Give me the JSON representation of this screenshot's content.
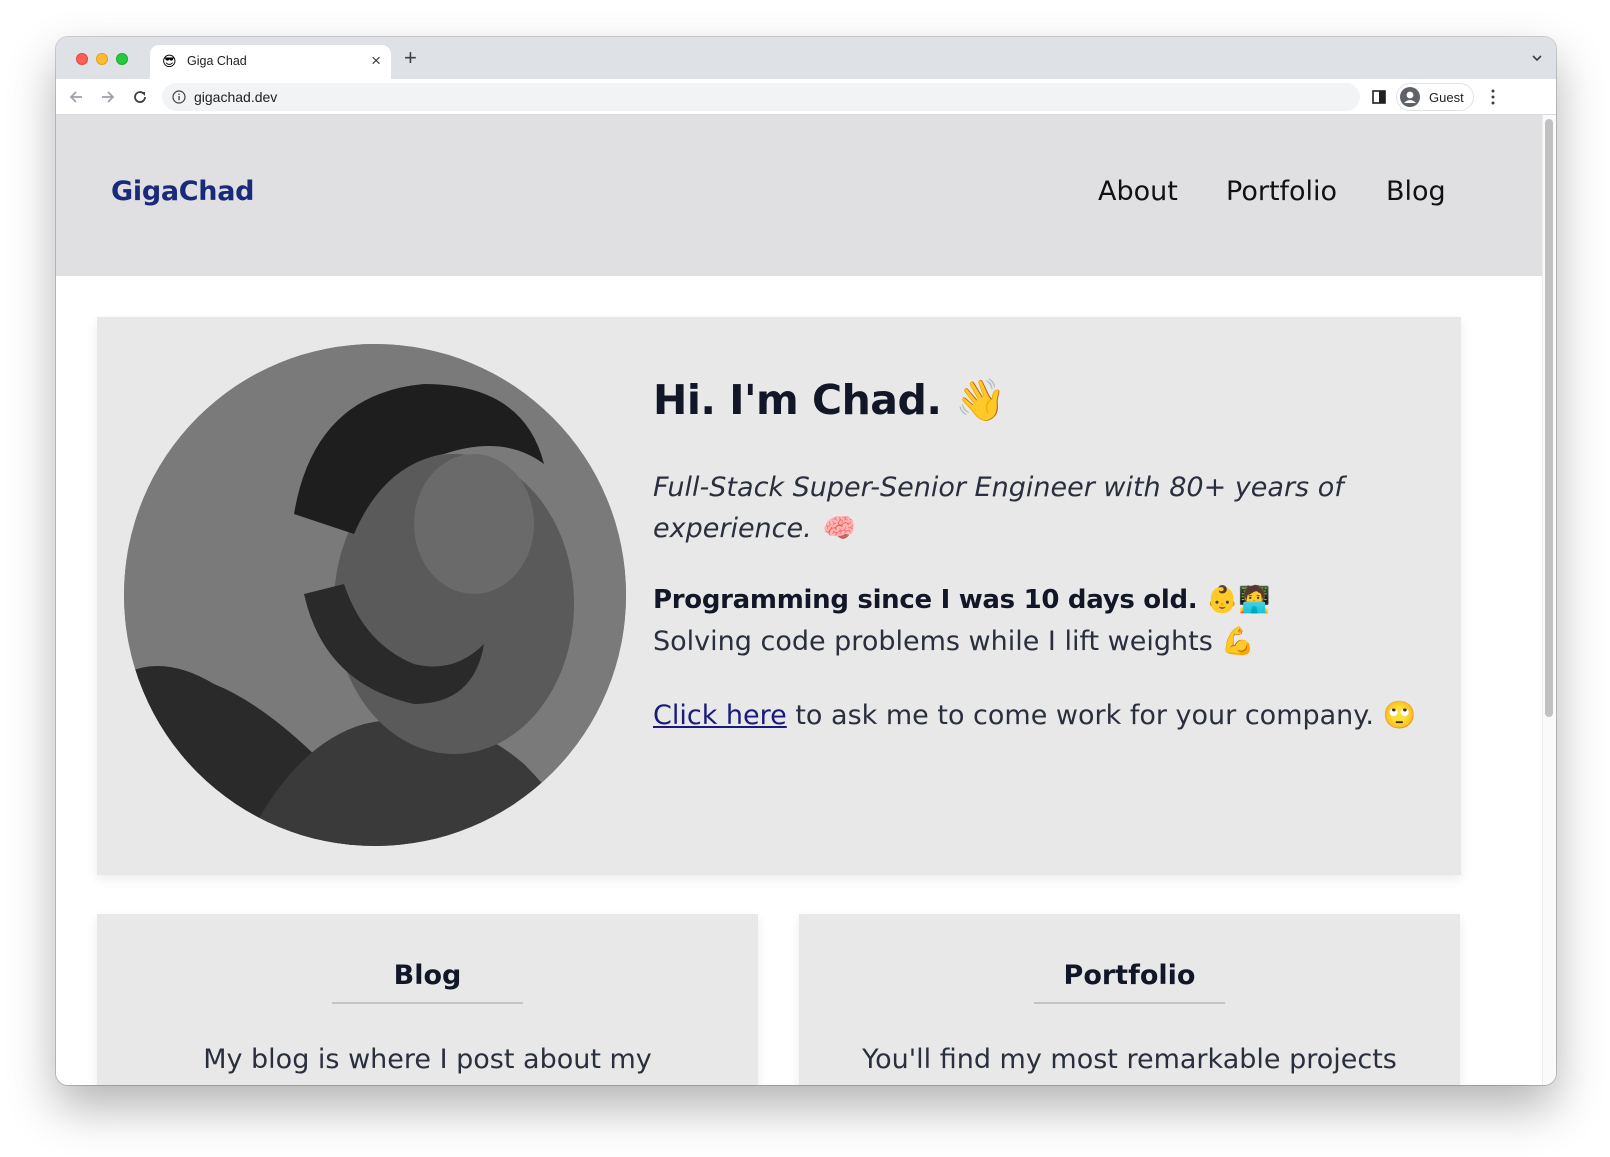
{
  "browser": {
    "tab": {
      "favicon": "😎",
      "title": "Giga Chad",
      "close": "×"
    },
    "new_tab": "+",
    "url": "gigachad.dev",
    "profile": "Guest"
  },
  "site": {
    "logo": "GigaChad",
    "nav": [
      {
        "label": "About"
      },
      {
        "label": "Portfolio"
      },
      {
        "label": "Blog"
      }
    ]
  },
  "hero": {
    "title": "Hi. I'm Chad. 👋",
    "subtitle": "Full-Stack Super-Senior Engineer with 80+ years of experience. 🧠",
    "bold_line": "Programming since I was 10 days old. 👶🧑‍💻",
    "line": "Solving code problems while I lift weights 💪",
    "cta_link": "Click here",
    "cta_rest": " to ask me to come work for your company. 🙄"
  },
  "cards": [
    {
      "title": "Blog",
      "body": "My blog is where I post about my"
    },
    {
      "title": "Portfolio",
      "body": "You'll find my most remarkable projects"
    }
  ]
}
